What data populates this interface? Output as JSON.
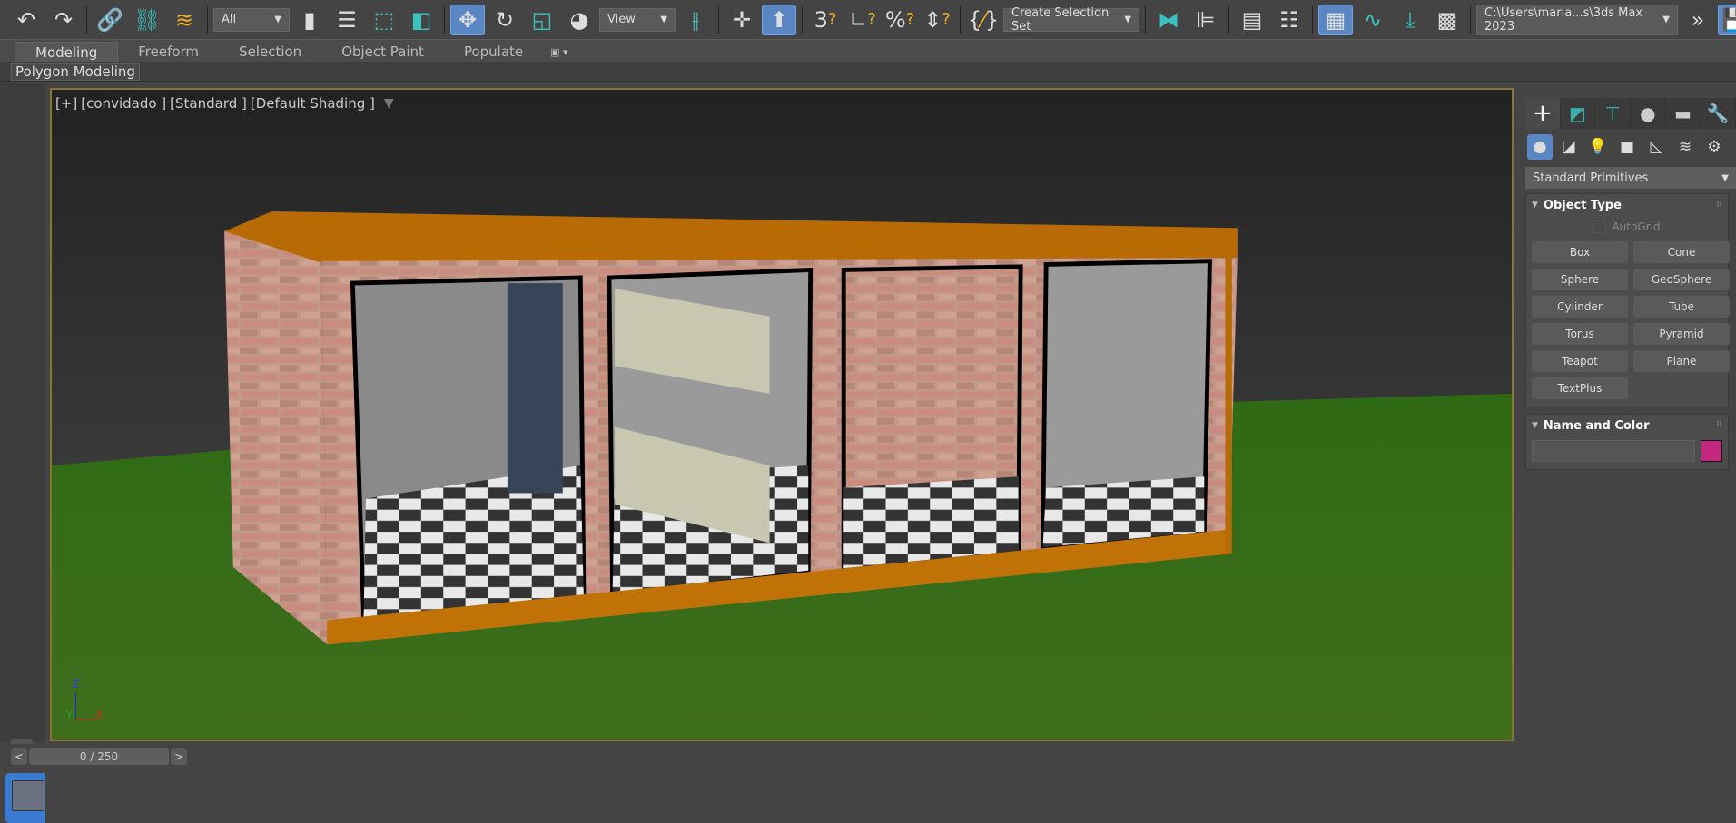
{
  "toolbar": {
    "selection_filter": "All",
    "reference_coord": "View",
    "named_selection": "Create Selection Set",
    "project_path": "C:\\Users\\maria...s\\3ds Max 2023",
    "icons": [
      "undo-icon",
      "redo-icon",
      "link-icon",
      "unlink-icon",
      "bind-space-warp-icon",
      "select-object-icon",
      "select-by-name-icon",
      "rectangular-selection-icon",
      "window-crossing-icon",
      "select-move-icon",
      "select-rotate-icon",
      "select-scale-icon",
      "select-place-icon",
      "use-pivot-icon",
      "select-manipulate-icon",
      "keyboard-shortcut-override-icon",
      "snaps-toggle-icon",
      "angle-snap-icon",
      "percent-snap-icon",
      "spinner-snap-icon",
      "edit-named-selection-icon",
      "mirror-icon",
      "align-icon",
      "scene-explorer-icon",
      "layer-explorer-icon",
      "toggle-ribbon-icon",
      "curve-editor-icon",
      "schematic-view-icon",
      "render-setup-icon",
      "overflow-icon",
      "workspace-save-icon"
    ]
  },
  "ribbon": {
    "tabs": [
      "Modeling",
      "Freeform",
      "Selection",
      "Object Paint",
      "Populate"
    ],
    "active_tab": "Modeling",
    "panel": "Polygon Modeling"
  },
  "viewport": {
    "label_parts": [
      "[+]",
      "[convidado ]",
      "[Standard ]",
      "[Default Shading ]"
    ],
    "axis": {
      "x": "X",
      "y": "Y",
      "z": "Z"
    }
  },
  "command_panel": {
    "tabs": [
      "create",
      "modify",
      "hierarchy",
      "motion",
      "display",
      "utilities"
    ],
    "category": "Standard Primitives",
    "object_type": {
      "title": "Object Type",
      "autogrid": "AutoGrid",
      "buttons": [
        "Box",
        "Cone",
        "Sphere",
        "GeoSphere",
        "Cylinder",
        "Tube",
        "Torus",
        "Pyramid",
        "Teapot",
        "Plane",
        "TextPlus"
      ]
    },
    "name_and_color": {
      "title": "Name and Color",
      "name_value": "",
      "color": "#c4287e"
    }
  },
  "timeline": {
    "current": "0 / 250",
    "prev": "<",
    "next": ">"
  },
  "colors": {
    "accent": "#5b86c4",
    "viewport_border": "#8a7430",
    "teal": "#3cc2be"
  }
}
